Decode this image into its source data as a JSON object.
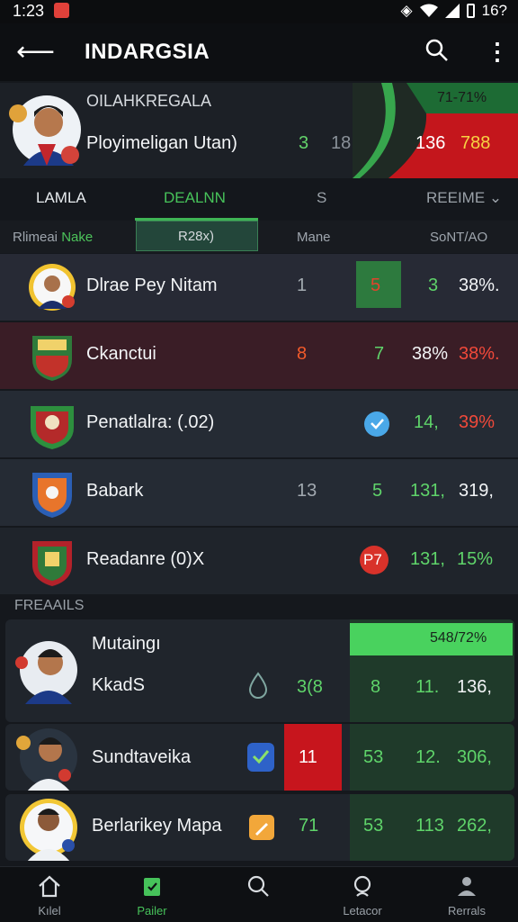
{
  "status_bar": {
    "time": "1:23",
    "battery": "16?"
  },
  "app_bar": {
    "title": "INDARGSIA"
  },
  "hero": {
    "team": "OILAHKREGALA",
    "player": "Ployimeligan Utan)",
    "stat_a": "3",
    "stat_b": "18",
    "rate": "71-71%",
    "score_a": "136",
    "score_b": "788",
    "colors": {
      "green": "#1d6b34",
      "red": "#c4161c",
      "yellow": "#f7d343"
    }
  },
  "tabs": [
    {
      "label": "LAMLA"
    },
    {
      "label": "DEALNN"
    },
    {
      "label": "S"
    },
    {
      "label": "REEIME ⌄"
    }
  ],
  "columns": {
    "col1": "Rlimeai",
    "col1_accent": "Nake",
    "col2": "R28x)",
    "col3": "Mane",
    "col4": "SoNT/AO"
  },
  "rows": [
    {
      "name": "Dlrae  Pey  Nitam",
      "a": "1",
      "b": "5",
      "c": "3",
      "d": "38%."
    },
    {
      "name": "Ckanctui",
      "a": "8",
      "b": "7",
      "c": "38%",
      "d": "38%."
    },
    {
      "name": "Penatlalra:  (.02)",
      "c": "14,",
      "d": "39%"
    },
    {
      "name": "Babark",
      "a": "13",
      "b": "5",
      "c": "131,",
      "d": "319,"
    },
    {
      "name": "Readanre   (0)X",
      "b": "P7",
      "c": "131,",
      "d": "15%"
    }
  ],
  "section": {
    "label": "FREAAILS"
  },
  "cards": [
    {
      "name_top": "Mutaingı",
      "name": "KkadS",
      "rate": "548/72%",
      "a": "3(8",
      "b": "8",
      "c": "11.",
      "d": "136,"
    },
    {
      "name": "Sundtaveika",
      "box": "11",
      "b": "53",
      "c": "12.",
      "d": "306,"
    },
    {
      "name": "Berlarikey  Mapa",
      "a": "71",
      "b": "53",
      "c": "113",
      "d": "262,"
    }
  ],
  "bottom_nav": [
    {
      "label": "Kılel"
    },
    {
      "label": "Pailer"
    },
    {
      "label": ""
    },
    {
      "label": "Letacor"
    },
    {
      "label": "Rerrals"
    }
  ]
}
